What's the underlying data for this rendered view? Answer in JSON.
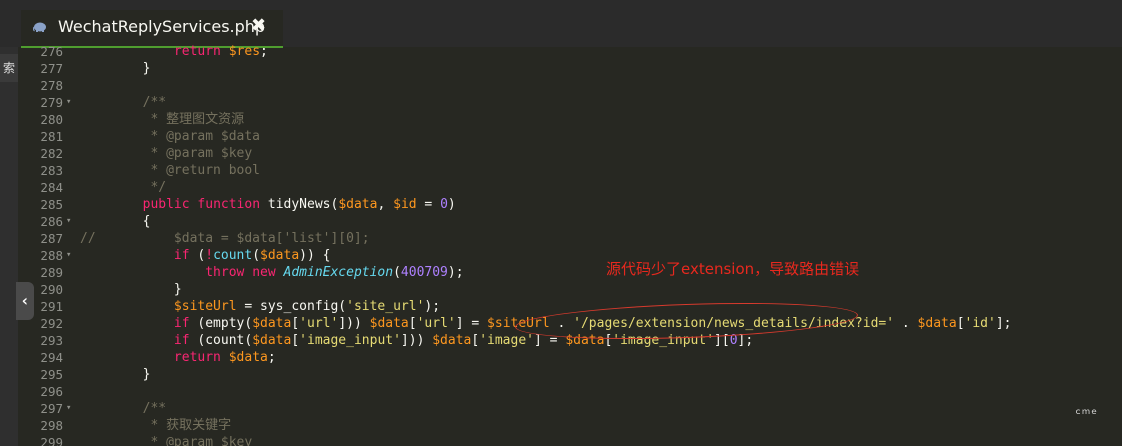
{
  "tab": {
    "title": "WechatReplyServices.php",
    "close_glyph": "✖"
  },
  "left_panel": {
    "tab_label": "索",
    "collapse_glyph": "‹"
  },
  "annotation": {
    "text": "源代码少了extension，导致路由错误",
    "color": "#e8281e"
  },
  "colors": {
    "editor_bg": "#272822",
    "keyword": "#f92672",
    "string": "#e6db74",
    "variable": "#fd971f",
    "number": "#ae81ff",
    "comment": "#75715e",
    "accent": "#4f9e2f"
  },
  "watermark": {
    "text": "ｃｍｅ"
  },
  "lines": [
    {
      "n": "276",
      "fold": "",
      "tokens": [
        {
          "t": "            "
        },
        {
          "t": "return",
          "c": "kw"
        },
        {
          "t": " "
        },
        {
          "t": "$res",
          "c": "vr"
        },
        {
          "t": ";"
        }
      ]
    },
    {
      "n": "277",
      "fold": "",
      "tokens": [
        {
          "t": "        }"
        }
      ]
    },
    {
      "n": "278",
      "fold": "",
      "tokens": []
    },
    {
      "n": "279",
      "fold": "▾",
      "tokens": [
        {
          "t": "        /**",
          "c": "cm"
        }
      ]
    },
    {
      "n": "280",
      "fold": "",
      "tokens": [
        {
          "t": "         * 整理图文资源",
          "c": "cm"
        }
      ]
    },
    {
      "n": "281",
      "fold": "",
      "tokens": [
        {
          "t": "         * @param $data",
          "c": "cm"
        }
      ]
    },
    {
      "n": "282",
      "fold": "",
      "tokens": [
        {
          "t": "         * @param $key",
          "c": "cm"
        }
      ]
    },
    {
      "n": "283",
      "fold": "",
      "tokens": [
        {
          "t": "         * @return bool",
          "c": "cm"
        }
      ]
    },
    {
      "n": "284",
      "fold": "",
      "tokens": [
        {
          "t": "         */",
          "c": "cm"
        }
      ]
    },
    {
      "n": "285",
      "fold": "",
      "tokens": [
        {
          "t": "        "
        },
        {
          "t": "public",
          "c": "kw"
        },
        {
          "t": " "
        },
        {
          "t": "function",
          "c": "kw"
        },
        {
          "t": " tidyNews("
        },
        {
          "t": "$data",
          "c": "vr"
        },
        {
          "t": ", "
        },
        {
          "t": "$id",
          "c": "vr"
        },
        {
          "t": " = "
        },
        {
          "t": "0",
          "c": "nm"
        },
        {
          "t": ")"
        }
      ]
    },
    {
      "n": "286",
      "fold": "▾",
      "tokens": [
        {
          "t": "        {"
        }
      ]
    },
    {
      "n": "287",
      "fold": "",
      "tokens": [
        {
          "t": "//          $data = $data['list'][0];",
          "c": "cm"
        }
      ]
    },
    {
      "n": "288",
      "fold": "▾",
      "tokens": [
        {
          "t": "            "
        },
        {
          "t": "if",
          "c": "kw"
        },
        {
          "t": " ("
        },
        {
          "t": "!",
          "c": "kw"
        },
        {
          "t": "count",
          "c": "fn"
        },
        {
          "t": "("
        },
        {
          "t": "$data",
          "c": "vr"
        },
        {
          "t": ")) {"
        }
      ]
    },
    {
      "n": "289",
      "fold": "",
      "tokens": [
        {
          "t": "                "
        },
        {
          "t": "throw",
          "c": "kw"
        },
        {
          "t": " "
        },
        {
          "t": "new",
          "c": "kw"
        },
        {
          "t": " "
        },
        {
          "t": "AdminException",
          "c": "cl"
        },
        {
          "t": "("
        },
        {
          "t": "400709",
          "c": "nm"
        },
        {
          "t": ");"
        }
      ]
    },
    {
      "n": "290",
      "fold": "",
      "tokens": [
        {
          "t": "            }"
        }
      ]
    },
    {
      "n": "291",
      "fold": "",
      "tokens": [
        {
          "t": "            "
        },
        {
          "t": "$siteUrl",
          "c": "vr"
        },
        {
          "t": " = sys_config("
        },
        {
          "t": "'site_url'",
          "c": "st"
        },
        {
          "t": ");"
        }
      ]
    },
    {
      "n": "292",
      "fold": "",
      "tokens": [
        {
          "t": "            "
        },
        {
          "t": "if",
          "c": "kw"
        },
        {
          "t": " (empty("
        },
        {
          "t": "$data",
          "c": "vr"
        },
        {
          "t": "["
        },
        {
          "t": "'url'",
          "c": "st"
        },
        {
          "t": "])) "
        },
        {
          "t": "$data",
          "c": "vr"
        },
        {
          "t": "["
        },
        {
          "t": "'url'",
          "c": "st"
        },
        {
          "t": "] = "
        },
        {
          "t": "$siteUrl",
          "c": "vr"
        },
        {
          "t": " . "
        },
        {
          "t": "'/pages/extension/news_details/index?id='",
          "c": "st"
        },
        {
          "t": " . "
        },
        {
          "t": "$data",
          "c": "vr"
        },
        {
          "t": "["
        },
        {
          "t": "'id'",
          "c": "st"
        },
        {
          "t": "];"
        }
      ]
    },
    {
      "n": "293",
      "fold": "",
      "tokens": [
        {
          "t": "            "
        },
        {
          "t": "if",
          "c": "kw"
        },
        {
          "t": " (count("
        },
        {
          "t": "$data",
          "c": "vr"
        },
        {
          "t": "["
        },
        {
          "t": "'image_input'",
          "c": "st"
        },
        {
          "t": "])) "
        },
        {
          "t": "$data",
          "c": "vr"
        },
        {
          "t": "["
        },
        {
          "t": "'image'",
          "c": "st"
        },
        {
          "t": "] = "
        },
        {
          "t": "$data",
          "c": "vr"
        },
        {
          "t": "["
        },
        {
          "t": "'image_input'",
          "c": "st"
        },
        {
          "t": "]["
        },
        {
          "t": "0",
          "c": "nm"
        },
        {
          "t": "];"
        }
      ]
    },
    {
      "n": "294",
      "fold": "",
      "tokens": [
        {
          "t": "            "
        },
        {
          "t": "return",
          "c": "kw"
        },
        {
          "t": " "
        },
        {
          "t": "$data",
          "c": "vr"
        },
        {
          "t": ";"
        }
      ]
    },
    {
      "n": "295",
      "fold": "",
      "tokens": [
        {
          "t": "        }"
        }
      ]
    },
    {
      "n": "296",
      "fold": "",
      "tokens": []
    },
    {
      "n": "297",
      "fold": "▾",
      "tokens": [
        {
          "t": "        /**",
          "c": "cm"
        }
      ]
    },
    {
      "n": "298",
      "fold": "",
      "tokens": [
        {
          "t": "         * 获取关键字",
          "c": "cm"
        }
      ]
    },
    {
      "n": "299",
      "fold": "",
      "tokens": [
        {
          "t": "         * @param $key",
          "c": "cm"
        }
      ]
    }
  ]
}
